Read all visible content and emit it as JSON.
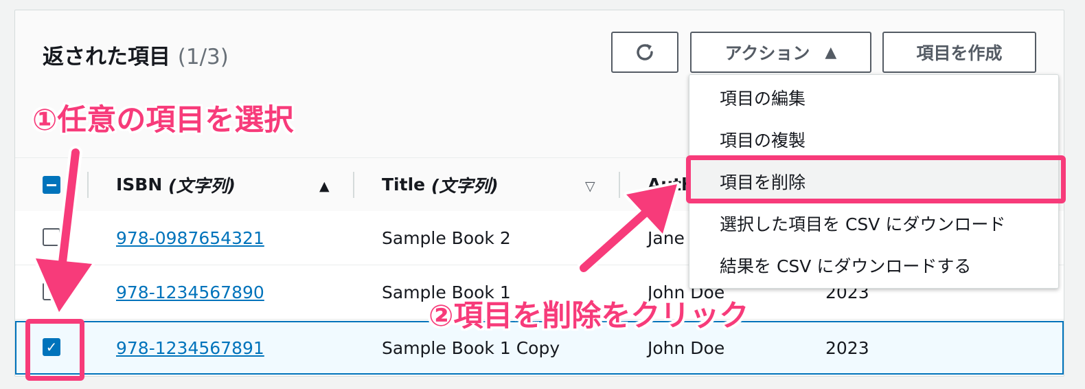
{
  "header": {
    "title": "返された項目",
    "count": "(1/3)",
    "refresh_icon": "refresh-icon",
    "action_label": "アクション",
    "action_caret_icon": "caret-up-icon",
    "create_label": "項目を作成"
  },
  "table": {
    "columns": [
      {
        "name": "ISBN",
        "type": "(文字列)",
        "sort": "ascending"
      },
      {
        "name": "Title",
        "type": "(文字列)",
        "sort": "none"
      },
      {
        "name": "Auth",
        "type": "",
        "sort": "none"
      }
    ],
    "rows": [
      {
        "isbn": "978-0987654321",
        "title": "Sample Book 2",
        "author": "Jane",
        "year": "",
        "checked": false
      },
      {
        "isbn": "978-1234567890",
        "title": "Sample Book 1",
        "author": "John Doe",
        "year": "2023",
        "checked": false
      },
      {
        "isbn": "978-1234567891",
        "title": "Sample Book 1 Copy",
        "author": "John Doe",
        "year": "2023",
        "checked": true
      }
    ]
  },
  "menu": {
    "items": [
      "項目の編集",
      "項目の複製",
      "項目を削除",
      "選択した項目を CSV にダウンロード",
      "結果を CSV にダウンロードする"
    ],
    "highlighted_index": 2
  },
  "annotations": {
    "step1": "①任意の項目を選択",
    "step2": "②項目を削除をクリック",
    "color": "#f73b7a"
  },
  "colors": {
    "accent": "#0073bb",
    "selected_row_bg": "#f1faff"
  }
}
